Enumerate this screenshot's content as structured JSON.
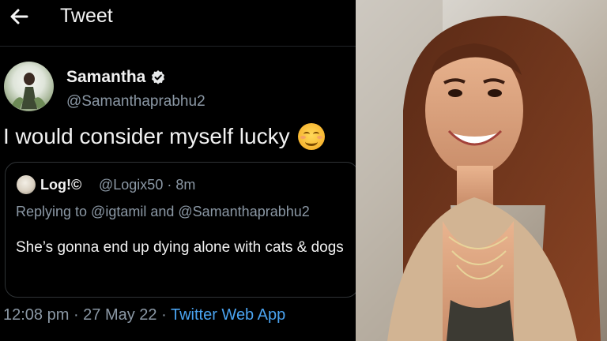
{
  "header": {
    "title": "Tweet",
    "back_icon": "arrow-left-icon"
  },
  "tweet": {
    "author_name": "Samantha",
    "verified_icon": "verified-badge-icon",
    "author_handle": "@Samanthaprabhu2",
    "text": "I would consider myself lucky",
    "emoji_icon": "smiling-blush-emoji-icon"
  },
  "quote": {
    "name": "Log!©",
    "handle": "@Logix50 · 8m",
    "replying": "Replying to @igtamil and @Samanthaprabhu2",
    "text": "She’s gonna end up dying alone with cats & dogs"
  },
  "meta": {
    "timestamp": "12:08 pm · 27 May 22 · ",
    "source": "Twitter Web App"
  },
  "colors": {
    "background": "#000000",
    "link": "#4aa3f0",
    "muted": "#8b98a5"
  },
  "photo": {
    "description_icon": "portrait-photo"
  }
}
